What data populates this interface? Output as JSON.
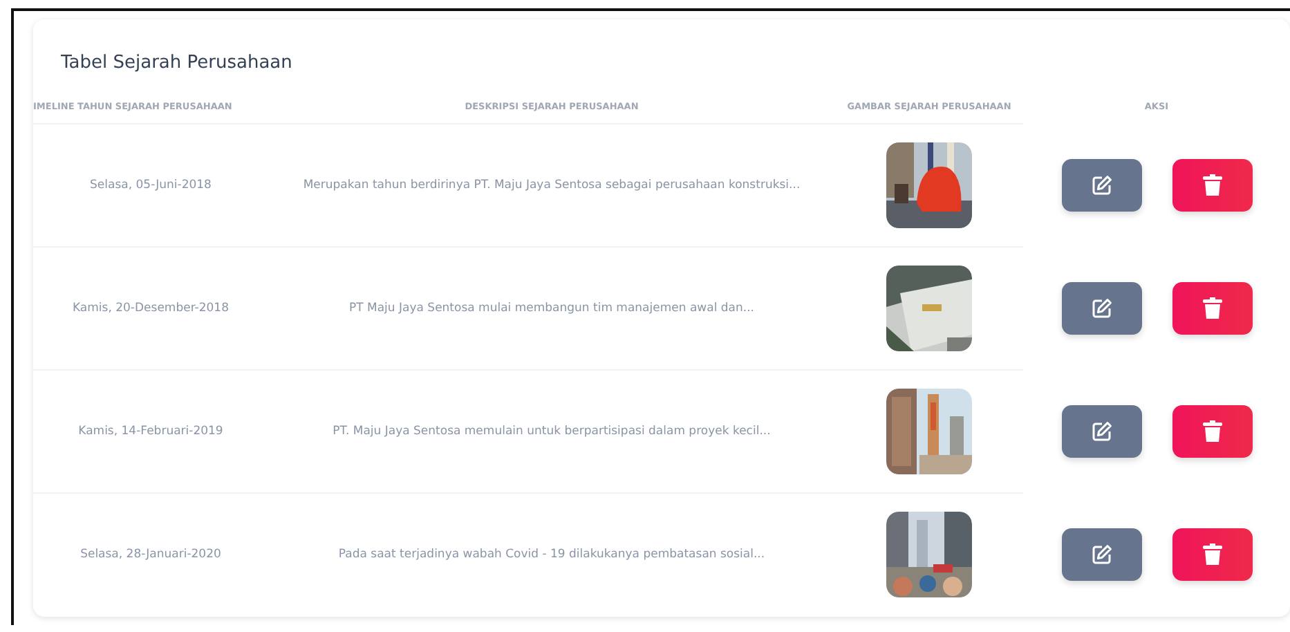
{
  "card": {
    "title": "Tabel Sejarah Perusahaan"
  },
  "table": {
    "columns": [
      "IMELINE TAHUN SEJARAH PERUSAHAAN",
      "DESKRIPSI SEJARAH PERUSAHAAN",
      "GAMBAR SEJARAH PERUSAHAAN",
      "AKSI"
    ],
    "rows": [
      {
        "date": "Selasa, 05-Juni-2018",
        "description": "Merupakan tahun berdirinya PT. Maju Jaya Sentosa sebagai perusahaan konstruksi..."
      },
      {
        "date": "Kamis, 20-Desember-2018",
        "description": "PT Maju Jaya Sentosa mulai membangun tim manajemen awal dan..."
      },
      {
        "date": "Kamis, 14-Februari-2019",
        "description": "PT. Maju Jaya Sentosa memulain untuk berpartisipasi dalam proyek kecil..."
      },
      {
        "date": "Selasa, 28-Januari-2020",
        "description": "Pada saat terjadinya wabah Covid - 19 dilakukanya pembatasan sosial..."
      }
    ]
  }
}
